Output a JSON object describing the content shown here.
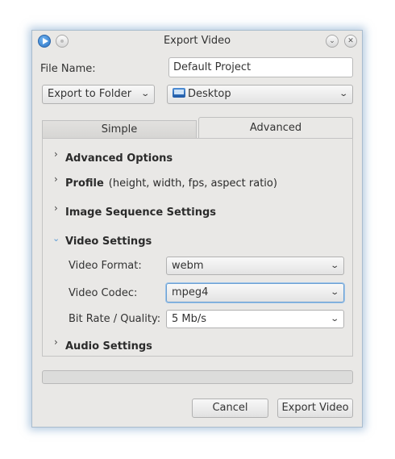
{
  "window": {
    "title": "Export Video"
  },
  "file": {
    "label": "File Name:",
    "value": "Default Project"
  },
  "export_target": {
    "selected": "Export to Folder"
  },
  "folder": {
    "selected": "Desktop"
  },
  "tabs": [
    {
      "label": "Simple",
      "active": false
    },
    {
      "label": "Advanced",
      "active": true
    }
  ],
  "sections": {
    "advanced_options": "Advanced Options",
    "profile": "Profile",
    "profile_detail": "(height, width, fps, aspect ratio)",
    "image_sequence": "Image Sequence Settings",
    "video_settings": "Video Settings",
    "audio_settings": "Audio Settings"
  },
  "video": {
    "format_label": "Video Format:",
    "format_value": "webm",
    "codec_label": "Video Codec:",
    "codec_value": "mpeg4",
    "bitrate_label": "Bit Rate / Quality:",
    "bitrate_value": "5 Mb/s"
  },
  "progress": {
    "value": 0
  },
  "buttons": {
    "cancel": "Cancel",
    "export": "Export Video"
  },
  "icons": {
    "app": "play-icon",
    "keep_above": "keep-above-icon",
    "minimize": "chevron-down-icon",
    "close": "close-icon",
    "folder": "folder-icon",
    "collapsed": "chevron-right-icon",
    "expanded": "chevron-down-icon"
  },
  "colors": {
    "window_bg": "#e9e8e6",
    "focus_border": "#6aa0d4",
    "expanded_arrow": "#5b9bd5"
  }
}
